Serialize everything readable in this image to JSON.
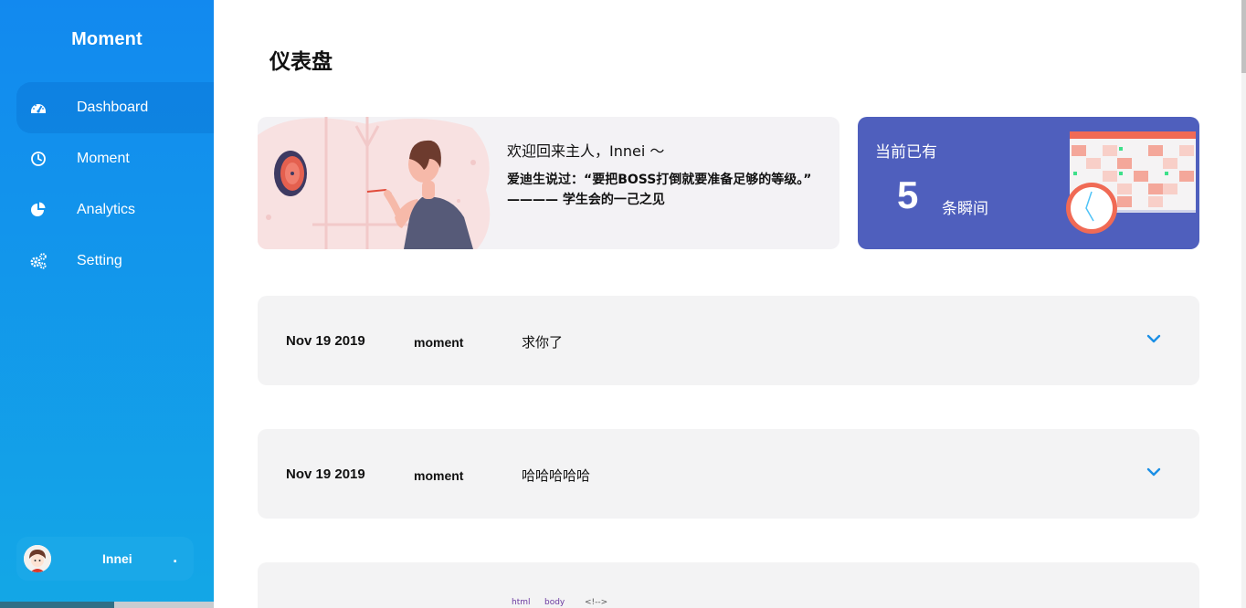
{
  "sidebar": {
    "brand": "Moment",
    "items": [
      {
        "label": "Dashboard",
        "icon": "dashboard-icon",
        "active": true
      },
      {
        "label": "Moment",
        "icon": "clock-icon",
        "active": false
      },
      {
        "label": "Analytics",
        "icon": "pie-chart-icon",
        "active": false
      },
      {
        "label": "Setting",
        "icon": "gears-icon",
        "active": false
      }
    ],
    "user": {
      "name": "Innei",
      "dot": "."
    }
  },
  "main": {
    "title": "仪表盘",
    "welcome": {
      "title": "欢迎回来主人，Innei ～",
      "quote": "爱迪生说过：“要把BOSS打倒就要准备足够的等级。” ———— 学生会的一己之见"
    },
    "stats": {
      "label": "当前已有",
      "count": "5",
      "unit": "条瞬间"
    },
    "moments": [
      {
        "date": "Nov 19 2019",
        "kind": "moment",
        "text": "求你了"
      },
      {
        "date": "Nov 19 2019",
        "kind": "moment",
        "text": "哈哈哈哈哈"
      },
      {
        "date": "",
        "kind": "",
        "text": ""
      }
    ]
  },
  "devtools": {
    "crumb1": "html",
    "crumb2": "body",
    "comment": "<!-->"
  },
  "colors": {
    "sidebar_top": "#1289ef",
    "sidebar_bottom": "#13a7e6",
    "stats_card": "#4f5fbd",
    "row_bg": "#f3f3f4",
    "chevron": "#1b8fe6"
  }
}
